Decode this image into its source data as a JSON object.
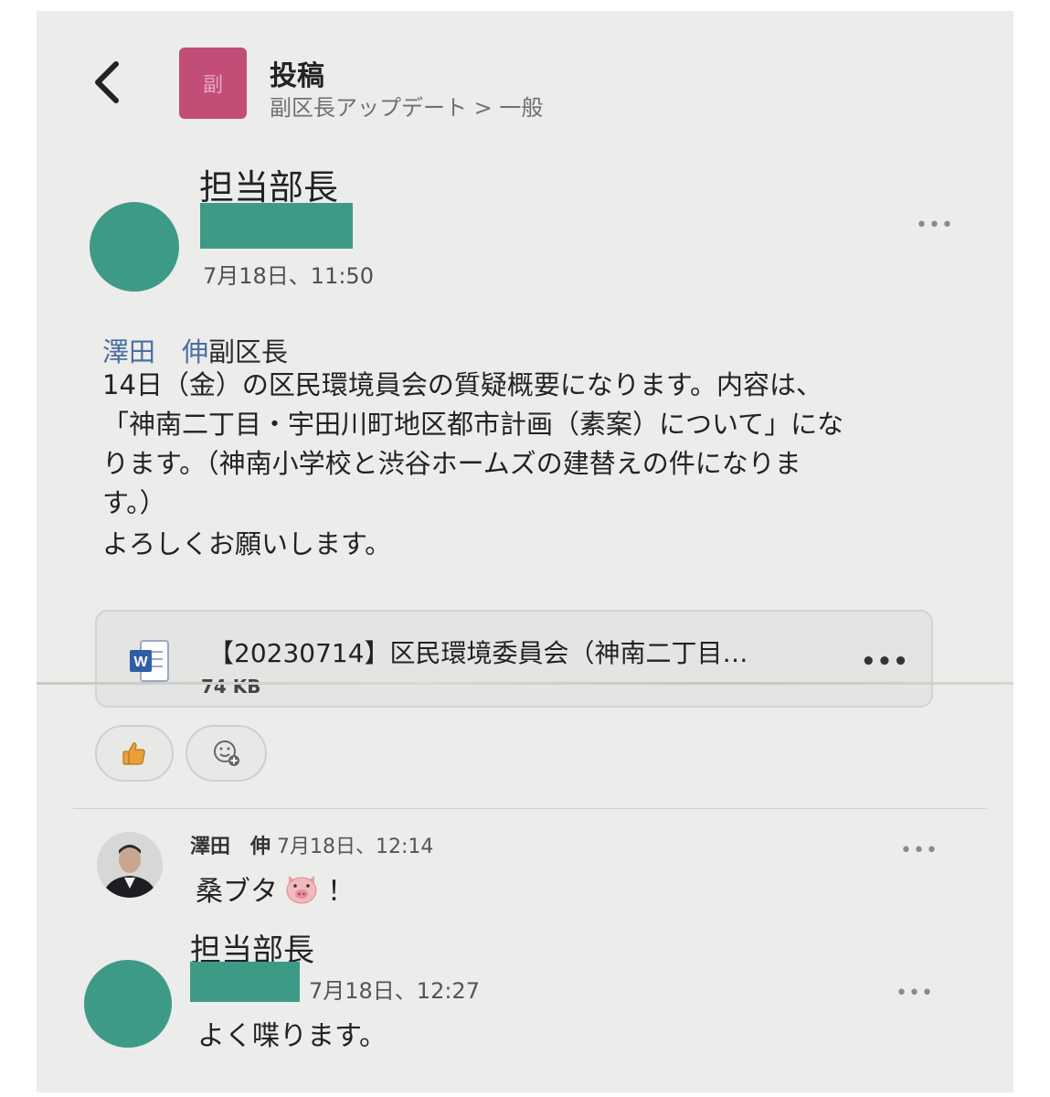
{
  "header": {
    "title": "投稿",
    "breadcrumb": "副区長アップデート > 一般",
    "channel_avatar_letter": "副",
    "accent_color": "#c24e78"
  },
  "post": {
    "author_role": "担当部長",
    "timestamp": "7月18日、11:50",
    "mention_name": "澤田　伸",
    "mention_title": "副区長",
    "body": "14日（金）の区民環境員会の質疑概要になります。内容は、\n「神南二丁目・宇田川町地区都市計画（素案）について」にな\nります。（神南小学校と渋谷ホームズの建替えの件になりま\nす。）",
    "closing": "よろしくお願いします。",
    "more_menu": "•••",
    "attachment": {
      "name": "【20230714】区民環境委員会（神南二丁目…",
      "size": "74 KB",
      "icon": "word-document-icon",
      "more_menu": "•••"
    },
    "reactions": [
      {
        "icon": "thumbs-up-icon"
      },
      {
        "icon": "add-reaction-icon"
      }
    ]
  },
  "replies": [
    {
      "author": "澤田　伸",
      "timestamp": "7月18日、12:14",
      "text_before": "桑ブタ",
      "emoji": "pig-face-icon",
      "text_after": "！",
      "more_menu": "•••"
    },
    {
      "author_role": "担当部長",
      "timestamp": "7月18日、12:27",
      "text": "よく喋ります。",
      "more_menu": "•••"
    }
  ],
  "colors": {
    "avatar_teal": "#3d9a86",
    "mention_blue": "#4a6fa1",
    "background": "#ececea"
  }
}
